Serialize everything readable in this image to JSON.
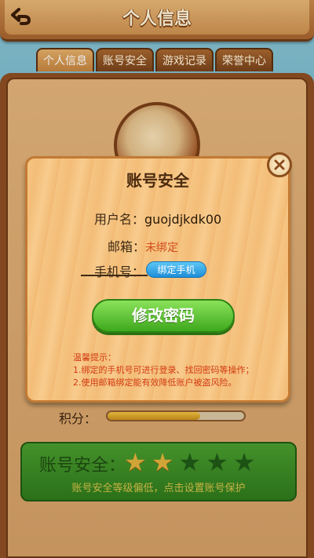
{
  "header": {
    "title": "个人信息",
    "back_icon": "back-arrow-icon"
  },
  "tabs": [
    {
      "label": "个人信息",
      "active": true
    },
    {
      "label": "账号安全",
      "active": false
    },
    {
      "label": "游戏记录",
      "active": false
    },
    {
      "label": "荣誉中心",
      "active": false
    }
  ],
  "profile": {
    "score_label": "积分：",
    "score_fill_fraction": 0.68
  },
  "security_box": {
    "label": "账号安全：",
    "stars_filled": 2,
    "stars_total": 5,
    "hint": "账号安全等级偏低，点击设置账号保护"
  },
  "modal": {
    "title": "账号安全",
    "username_label": "用户名：",
    "username_value": "guojdjkdk00",
    "email_label": "邮箱：",
    "email_value": "未绑定",
    "phone_label": "手机号：",
    "bind_phone_button": "绑定手机",
    "change_password_button": "修改密码",
    "tips_title": "温馨提示：",
    "tip_1": "1.绑定的手机号可进行登录、找回密码等操作；",
    "tip_2": "2.使用邮箱绑定能有效降低账户被盗风险。",
    "close_icon": "close-icon"
  },
  "colors": {
    "accent_green": "#3ea91d",
    "bind_blue": "#1f8fd8",
    "warning_red": "#d24a1a",
    "star_gold": "#e3b23c"
  }
}
